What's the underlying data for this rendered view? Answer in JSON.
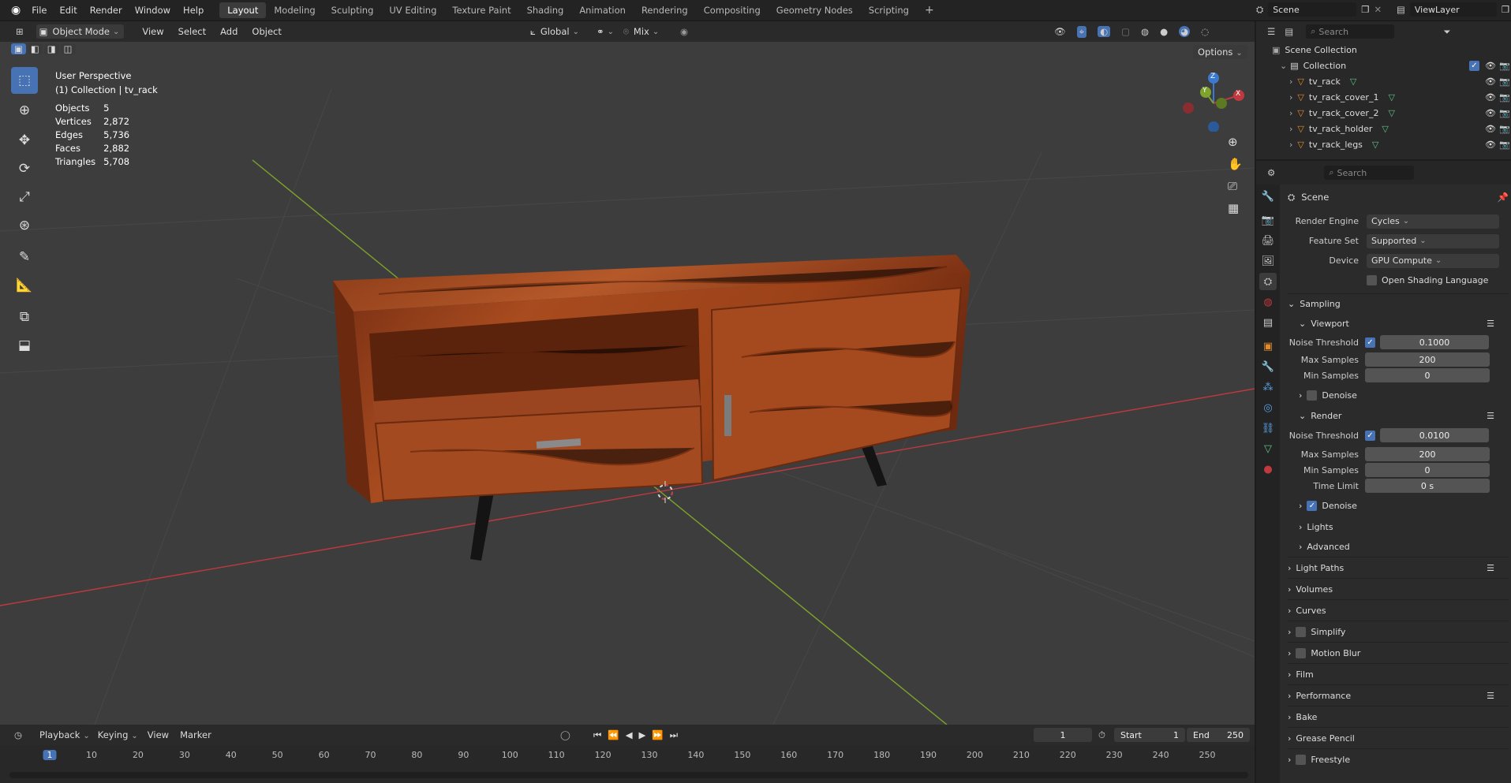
{
  "topbar": {
    "menus": [
      "File",
      "Edit",
      "Render",
      "Window",
      "Help"
    ],
    "workspaces": [
      "Layout",
      "Modeling",
      "Sculpting",
      "UV Editing",
      "Texture Paint",
      "Shading",
      "Animation",
      "Rendering",
      "Compositing",
      "Geometry Nodes",
      "Scripting"
    ],
    "add_tab": "+",
    "scene_name": "Scene",
    "view_layer": "ViewLayer"
  },
  "viewport_header": {
    "mode": "Object Mode",
    "menus": [
      "View",
      "Select",
      "Add",
      "Object"
    ],
    "orientation": "Global",
    "snap_mode": "Mix",
    "options_label": "Options"
  },
  "overlay": {
    "view_name": "User Perspective",
    "collection_info": "(1) Collection | tv_rack",
    "stats": [
      {
        "label": "Objects",
        "value": "5"
      },
      {
        "label": "Vertices",
        "value": "2,872"
      },
      {
        "label": "Edges",
        "value": "5,736"
      },
      {
        "label": "Faces",
        "value": "2,882"
      },
      {
        "label": "Triangles",
        "value": "5,708"
      }
    ],
    "gizmo": {
      "x": "X",
      "y": "Y",
      "z": "Z"
    }
  },
  "outliner": {
    "search_placeholder": "Search",
    "root": "Scene Collection",
    "collection": "Collection",
    "objects": [
      "tv_rack",
      "tv_rack_cover_1",
      "tv_rack_cover_2",
      "tv_rack_holder",
      "tv_rack_legs"
    ]
  },
  "properties": {
    "search_placeholder": "Search",
    "context": "Scene",
    "render_engine_label": "Render Engine",
    "render_engine": "Cycles",
    "feature_set_label": "Feature Set",
    "feature_set": "Supported",
    "device_label": "Device",
    "device": "GPU Compute",
    "osl_label": "Open Shading Language",
    "sampling": "Sampling",
    "viewport": "Viewport",
    "noise_threshold_label": "Noise Threshold",
    "viewport_noise_threshold": "0.1000",
    "max_samples_label": "Max Samples",
    "viewport_max_samples": "200",
    "min_samples_label": "Min Samples",
    "viewport_min_samples": "0",
    "denoise_label": "Denoise",
    "render": "Render",
    "render_noise_threshold": "0.0100",
    "render_max_samples": "200",
    "render_min_samples": "0",
    "time_limit_label": "Time Limit",
    "time_limit": "0 s",
    "lights": "Lights",
    "advanced": "Advanced",
    "panels": [
      "Light Paths",
      "Volumes",
      "Curves",
      "Simplify",
      "Motion Blur",
      "Film",
      "Performance",
      "Bake",
      "Grease Pencil",
      "Freestyle"
    ]
  },
  "timeline": {
    "menus": [
      "Playback",
      "Keying",
      "View",
      "Marker"
    ],
    "current_frame": "1",
    "start_label": "Start",
    "start": "1",
    "end_label": "End",
    "end": "250",
    "ticks": [
      "1",
      "10",
      "20",
      "30",
      "40",
      "50",
      "60",
      "70",
      "80",
      "90",
      "100",
      "110",
      "120",
      "130",
      "140",
      "150",
      "160",
      "170",
      "180",
      "190",
      "200",
      "210",
      "220",
      "230",
      "240",
      "250"
    ]
  },
  "colors": {
    "accent": "#4772b3",
    "x_axis": "#c0393e",
    "y_axis": "#7ea32c",
    "z_axis": "#3b7ad0",
    "wood": "#a34a1e"
  }
}
